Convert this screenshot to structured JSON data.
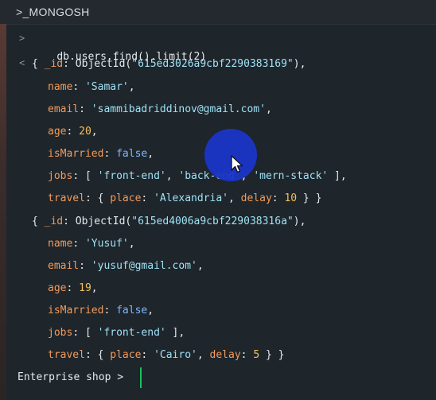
{
  "header": {
    "title": ">_MONGOSH"
  },
  "prompt_symbol": ">",
  "result_symbol": "<",
  "command": "db.users.find().limit(2)",
  "docs": [
    {
      "id_key": "_id",
      "id_fn": "ObjectId",
      "id_value": "\"615ed3026a9cbf2290383169\"",
      "fields": [
        {
          "k": "name",
          "v": "'Samar'",
          "t": "str"
        },
        {
          "k": "email",
          "v": "'sammibadriddinov@gmail.com'",
          "t": "str"
        },
        {
          "k": "age",
          "v": "20",
          "t": "num"
        },
        {
          "k": "isMarried",
          "v": "false",
          "t": "bool"
        }
      ],
      "jobs_key": "jobs",
      "jobs": [
        "'front-end'",
        "'back-end'",
        "'mern-stack'"
      ],
      "travel_key": "travel",
      "place_key": "place",
      "place": "'Alexandria'",
      "delay_key": "delay",
      "delay": "10"
    },
    {
      "id_key": "_id",
      "id_fn": "ObjectId",
      "id_value": "\"615ed4006a9cbf229038316a\"",
      "fields": [
        {
          "k": "name",
          "v": "'Yusuf'",
          "t": "str"
        },
        {
          "k": "email",
          "v": "'yusuf@gmail.com'",
          "t": "str"
        },
        {
          "k": "age",
          "v": "19",
          "t": "num"
        },
        {
          "k": "isMarried",
          "v": "false",
          "t": "bool"
        }
      ],
      "jobs_key": "jobs",
      "jobs": [
        "'front-end'"
      ],
      "travel_key": "travel",
      "place_key": "place",
      "place": "'Cairo'",
      "delay_key": "delay",
      "delay": "5"
    }
  ],
  "footer_prompt": "Enterprise shop",
  "colors": {
    "background": "#1e252b",
    "key": "#f39b5b",
    "string": "#9fe2f5",
    "number": "#f1c15d",
    "boolean": "#7fb8ff",
    "cursor": "#18c35a",
    "pointer_highlight": "#1b35c8"
  },
  "icons": [
    "pointer-cursor-icon",
    "text-cursor-icon"
  ]
}
